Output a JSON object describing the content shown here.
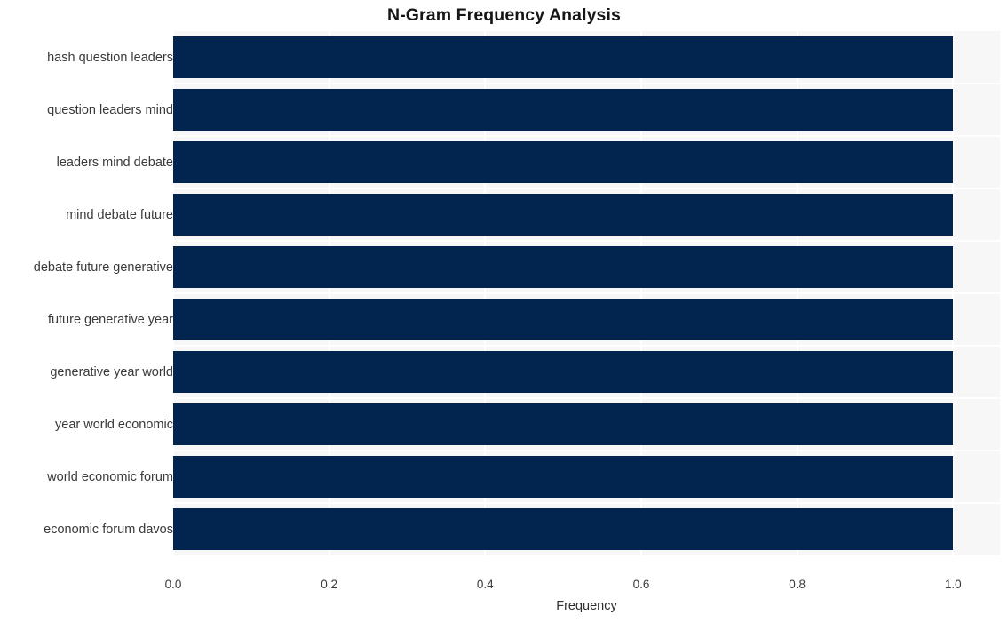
{
  "chart_data": {
    "type": "bar",
    "orientation": "horizontal",
    "title": "N-Gram Frequency Analysis",
    "xlabel": "Frequency",
    "ylabel": "",
    "categories": [
      "hash question leaders",
      "question leaders mind",
      "leaders mind debate",
      "mind debate future",
      "debate future generative",
      "future generative year",
      "generative year world",
      "year world economic",
      "world economic forum",
      "economic forum davos"
    ],
    "values": [
      1.0,
      1.0,
      1.0,
      1.0,
      1.0,
      1.0,
      1.0,
      1.0,
      1.0,
      1.0
    ],
    "xlim": [
      0.0,
      1.06
    ],
    "xticks": [
      0.0,
      0.2,
      0.4,
      0.6,
      0.8,
      1.0
    ],
    "xtick_labels": [
      "0.0",
      "0.2",
      "0.4",
      "0.6",
      "0.8",
      "1.0"
    ],
    "grid": true,
    "grid_color": "#ffffff",
    "legend": null,
    "bar_color": "#022550",
    "plot_background": "#f7f7f8",
    "figure_background": "#ffffff"
  }
}
